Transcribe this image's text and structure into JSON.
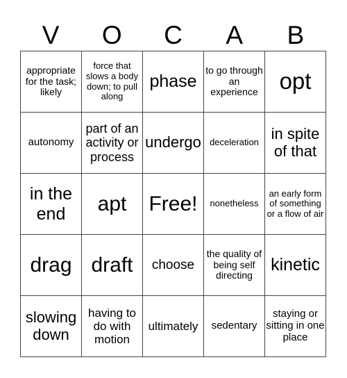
{
  "header": {
    "letters": [
      "V",
      "O",
      "C",
      "A",
      "B"
    ]
  },
  "cells": [
    "appropriate for the task; likely",
    "force that slows a body down; to pull along",
    "phase",
    "to go through an experience",
    "opt",
    "autonomy",
    "part of an activity or process",
    "undergo",
    "deceleration",
    "in spite of that",
    "in the end",
    "apt",
    "Free!",
    "nonetheless",
    "an early form of something or a flow of air",
    "drag",
    "draft",
    "choose",
    "the quality of being self directing",
    "kinetic",
    "slowing down",
    "having to do with motion",
    "ultimately",
    "sedentary",
    "staying or sitting in one place"
  ]
}
